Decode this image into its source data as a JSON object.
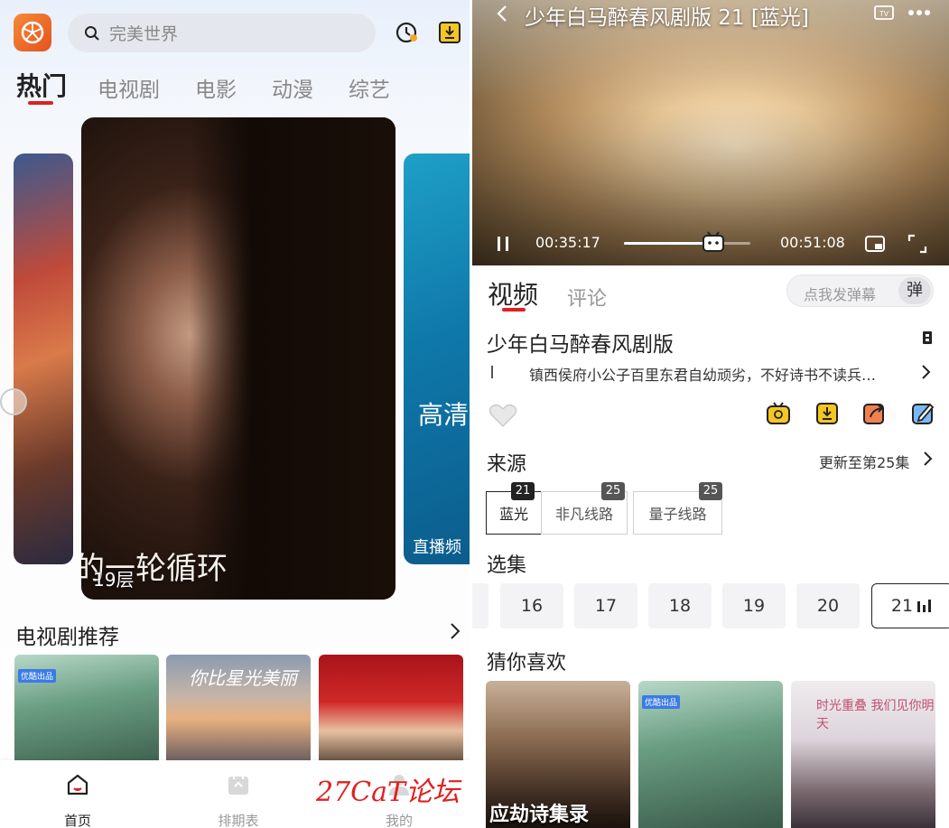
{
  "left": {
    "search_placeholder": "完美世界",
    "tabs": [
      "热门",
      "电视剧",
      "电影",
      "动漫",
      "综艺"
    ],
    "banner": {
      "caption": "的一轮循环",
      "floor": "19层",
      "right_text": "高清",
      "right_sub": "直播频"
    },
    "section_title": "电视剧推荐",
    "thumb2_title": "你比星光美丽",
    "badge": "优酷出品",
    "nav": [
      "首页",
      "排期表",
      "我的"
    ]
  },
  "right": {
    "player": {
      "title": "少年白马醉春风剧版 21 [蓝光]",
      "time_current": "00:35:17",
      "time_total": "00:51:08",
      "progress": 0.69
    },
    "tabs": [
      "视频",
      "评论"
    ],
    "danmu_placeholder": "点我发弹幕",
    "danmu_button": "弹",
    "show_title": "少年白马醉春风剧版",
    "description": "镇西侯府小公子百里东君自幼顽劣，不好诗书不读兵…",
    "source_title": "来源",
    "source_update": "更新至第25集",
    "lines": [
      {
        "name": "蓝光",
        "count": "21"
      },
      {
        "name": "非凡线路",
        "count": "25"
      },
      {
        "name": "量子线路",
        "count": "25"
      }
    ],
    "episodes_title": "选集",
    "episodes": [
      "16",
      "17",
      "18",
      "19",
      "20",
      "21"
    ],
    "rec_title": "猜你喜欢",
    "rec1_title": "应劫诗集录",
    "rec3_title": "时光重叠 我们见你明天",
    "badge": "优酷出品",
    "watermark": "27CaT论坛"
  }
}
